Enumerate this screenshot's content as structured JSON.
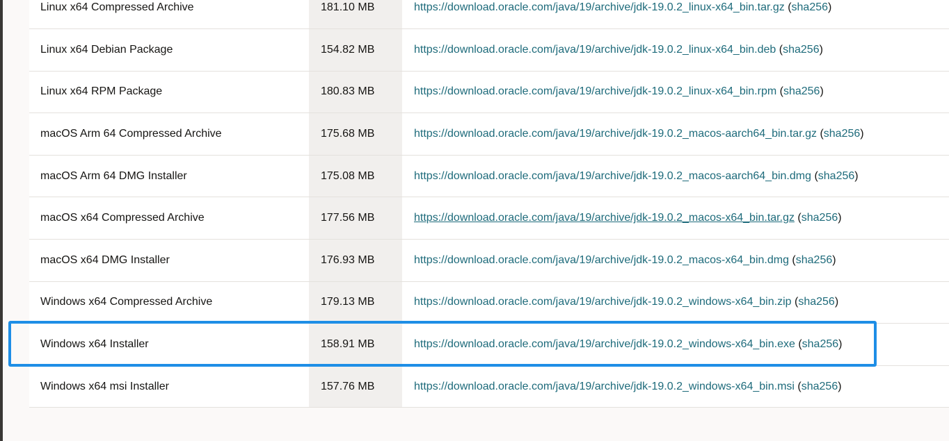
{
  "downloads": {
    "rows": [
      {
        "product": "Linux x64 Compressed Archive",
        "size": "181.10 MB",
        "url": "https://download.oracle.com/java/19/archive/jdk-19.0.2_linux-x64_bin.tar.gz",
        "checksum": "sha256"
      },
      {
        "product": "Linux x64 Debian Package",
        "size": "154.82 MB",
        "url": "https://download.oracle.com/java/19/archive/jdk-19.0.2_linux-x64_bin.deb",
        "checksum": "sha256"
      },
      {
        "product": "Linux x64 RPM Package",
        "size": "180.83 MB",
        "url": "https://download.oracle.com/java/19/archive/jdk-19.0.2_linux-x64_bin.rpm",
        "checksum": "sha256"
      },
      {
        "product": "macOS Arm 64 Compressed Archive",
        "size": "175.68 MB",
        "url": "https://download.oracle.com/java/19/archive/jdk-19.0.2_macos-aarch64_bin.tar.gz",
        "checksum": "sha256"
      },
      {
        "product": "macOS Arm 64 DMG Installer",
        "size": "175.08 MB",
        "url": "https://download.oracle.com/java/19/archive/jdk-19.0.2_macos-aarch64_bin.dmg",
        "checksum": "sha256"
      },
      {
        "product": "macOS x64 Compressed Archive",
        "size": "177.56 MB",
        "url": "https://download.oracle.com/java/19/archive/jdk-19.0.2_macos-x64_bin.tar.gz",
        "checksum": "sha256"
      },
      {
        "product": "macOS x64 DMG Installer",
        "size": "176.93 MB",
        "url": "https://download.oracle.com/java/19/archive/jdk-19.0.2_macos-x64_bin.dmg",
        "checksum": "sha256"
      },
      {
        "product": "Windows x64 Compressed Archive",
        "size": "179.13 MB",
        "url": "https://download.oracle.com/java/19/archive/jdk-19.0.2_windows-x64_bin.zip",
        "checksum": "sha256"
      },
      {
        "product": "Windows x64 Installer",
        "size": "158.91 MB",
        "url": "https://download.oracle.com/java/19/archive/jdk-19.0.2_windows-x64_bin.exe",
        "checksum": "sha256"
      },
      {
        "product": "Windows x64 msi Installer",
        "size": "157.76 MB",
        "url": "https://download.oracle.com/java/19/archive/jdk-19.0.2_windows-x64_bin.msi",
        "checksum": "sha256"
      }
    ],
    "hovered_row_index": 5,
    "highlighted_row_index": 8
  },
  "colors": {
    "link": "#1e6b7b",
    "highlight_border": "#1e8ee6",
    "size_column_bg": "#f1efed"
  }
}
